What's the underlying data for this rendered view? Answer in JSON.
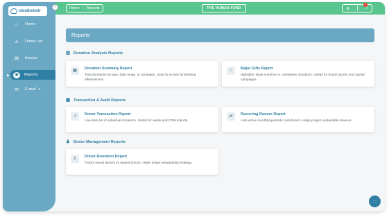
{
  "logo": {
    "text": "cloudomoir"
  },
  "sidebar": {
    "collapse_icon": "chevron-left-icon",
    "items": [
      {
        "label": "Home",
        "icon": "home-icon"
      },
      {
        "label": "Donor List",
        "icon": "user-icon"
      },
      {
        "label": "Invoice",
        "icon": "invoice-icon"
      },
      {
        "label": "Reports",
        "icon": "reports-icon",
        "active": true
      },
      {
        "label": "E-mail",
        "icon": "mail-icon",
        "has_dropdown": true
      }
    ]
  },
  "topbar": {
    "breadcrumb": [
      "Home",
      "Reports"
    ],
    "org_name": "THE HUMAN FUND",
    "notification_count": "1"
  },
  "page": {
    "title": "Reports"
  },
  "sections": [
    {
      "title": "Donation Analysis Reports",
      "cards": [
        {
          "title": "Donation Summary Report",
          "desc": "Total donations by type, date range, or campaign. Used to access fundraising effectiveness."
        },
        {
          "title": "Major Gifts Report",
          "desc": "Highlights large one-time or cumulative donations. Useful for board reports and capital campaigns."
        }
      ]
    },
    {
      "title": "Transaction & Audit Reports",
      "cards": [
        {
          "title": "Donor Transaction Report",
          "desc": "Line-item list of individual donations. Useful for audits and CRM imports."
        },
        {
          "title": "Recurring Donors Report",
          "desc": "Lists active monthly/quarterly contributors. Helps project sustainable revenue."
        }
      ]
    },
    {
      "title": "Donor Management Reports",
      "cards": [
        {
          "title": "Donor Retention Report",
          "desc": "Tracks repeat donors vs lapsed donors. Helps shape stewardship strategy."
        }
      ]
    }
  ],
  "colors": {
    "sidebar": "#6aa8c4",
    "topbar": "#58c48e",
    "accent": "#2e7fa3"
  }
}
